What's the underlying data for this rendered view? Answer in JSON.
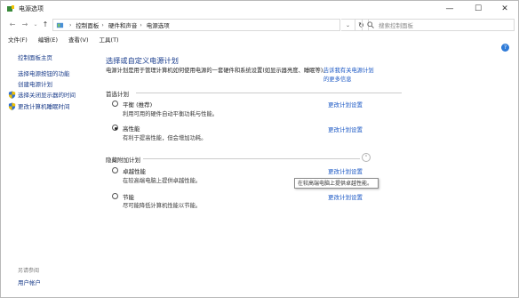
{
  "window": {
    "title": "电源选项",
    "controls": {
      "minimize": "—",
      "maximize": "☐",
      "close": "✕"
    }
  },
  "navigation": {
    "back": "←",
    "forward": "→",
    "recent": "⌄",
    "up": "↑",
    "breadcrumbs": [
      "控制面板",
      "硬件和声音",
      "电源选项"
    ],
    "dropdown": "⌄",
    "refresh": "↻",
    "search_placeholder": "搜索控制面板"
  },
  "menu": [
    "文件(F)",
    "编辑(E)",
    "查看(V)",
    "工具(T)"
  ],
  "help": "?",
  "left_pane": {
    "home": "控制面板主页",
    "links": [
      "选择电源按钮的功能",
      "创建电源计划",
      "选择关闭显示器的时间",
      "更改计算机睡眠时间"
    ],
    "see_also": "另请参阅",
    "user_accounts": "用户帐户"
  },
  "main": {
    "title": "选择或自定义电源计划",
    "description": "电源计划是用于管理计算机如何使用电源的一套硬件和系统设置(如显示器亮度、睡眠等)。",
    "description_link": "告诉我有关电源计划的更多信息",
    "preferred_group": "首选计划",
    "hidden_group": "隐藏附加计划",
    "collapse": "⌃",
    "change_link": "更改计划设置",
    "plans": [
      {
        "name": "平衡 (推荐)",
        "desc": "利用可用的硬件自动平衡功耗与性能。",
        "selected": false
      },
      {
        "name": "高性能",
        "desc": "有利于提高性能，但会增加功耗。",
        "selected": true
      },
      {
        "name": "卓越性能",
        "desc": "在较高端电脑上提供卓越性能。",
        "selected": false
      },
      {
        "name": "节能",
        "desc": "尽可能降低计算机性能以节能。",
        "selected": false
      }
    ],
    "tooltip": "在较高端电脑上提供卓越性能。"
  }
}
